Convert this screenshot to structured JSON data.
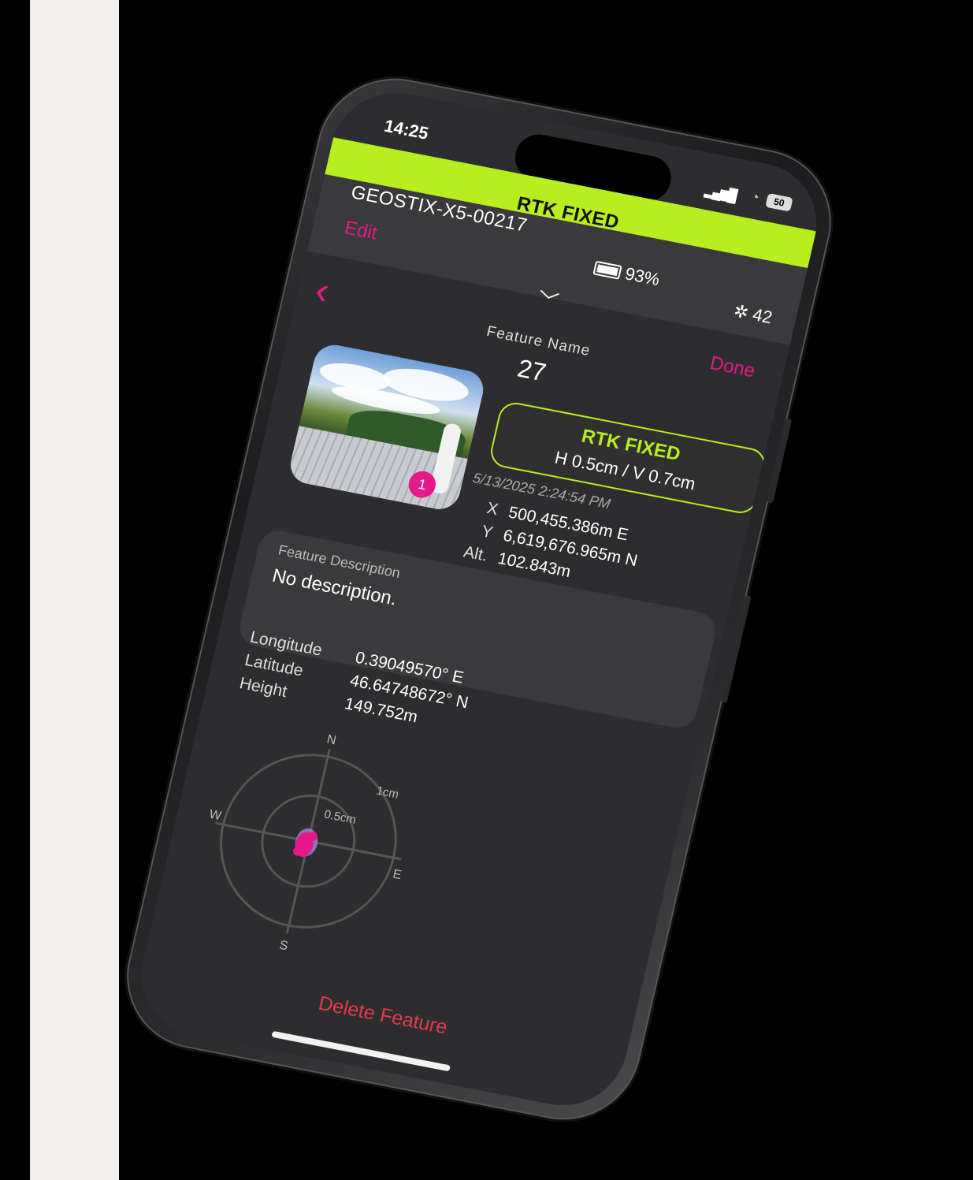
{
  "status": {
    "time": "14:25",
    "battery_level": "50"
  },
  "banner": {
    "fix_label": "RTK FIXED"
  },
  "device": {
    "id": "GEOSTIX-X5-00217",
    "edit_label": "Edit",
    "battery": "93%",
    "satellites": "42"
  },
  "nav": {
    "done_label": "Done"
  },
  "feature": {
    "name_label": "Feature Name",
    "name": "27",
    "photo_count": "1",
    "fix": {
      "label": "RTK FIXED",
      "accuracy": "H 0.5cm / V 0.7cm"
    },
    "timestamp": "5/13/2025 2:24:54 PM",
    "coords": [
      {
        "label": "X",
        "value": "500,455.386m E"
      },
      {
        "label": "Y",
        "value": "6,619,676.965m N"
      },
      {
        "label": "Alt.",
        "value": "102.843m"
      }
    ],
    "description_label": "Feature Description",
    "description": "No description.",
    "geo": [
      {
        "label": "Longitude",
        "value": "0.39049570° E"
      },
      {
        "label": "Latitude",
        "value": "46.64748672° N"
      },
      {
        "label": "Height",
        "value": "149.752m"
      }
    ]
  },
  "precision_plot": {
    "north": "N",
    "south": "S",
    "east": "E",
    "west": "W",
    "ring_outer": "1cm",
    "ring_inner": "0.5cm",
    "point_color": "#e6198a"
  },
  "actions": {
    "delete_label": "Delete Feature"
  },
  "colors": {
    "accent": "#e6198a",
    "fix_green": "#b6ee1f",
    "danger": "#e23a4a"
  }
}
